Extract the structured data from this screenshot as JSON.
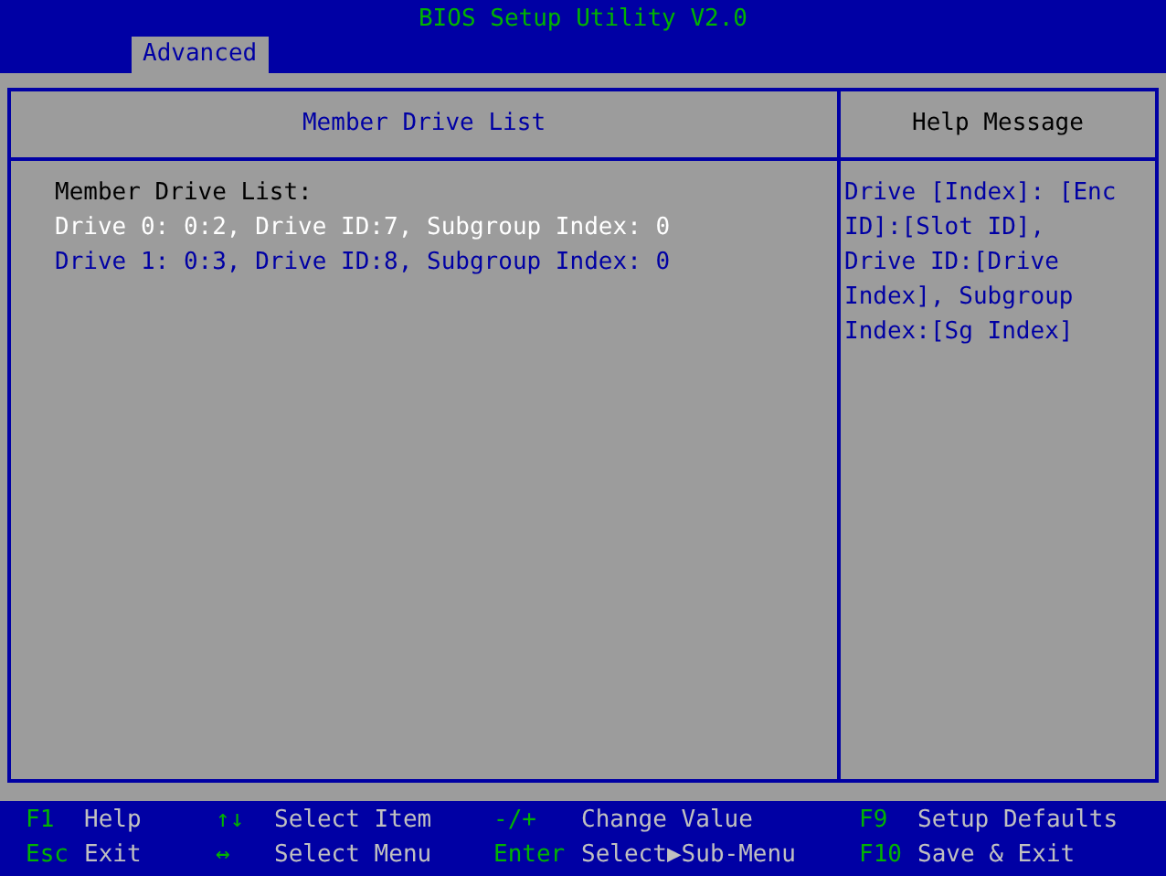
{
  "window": {
    "title": "BIOS Setup Utility V2.0"
  },
  "tabs": [
    {
      "label": "Advanced",
      "selected": true
    }
  ],
  "main_panel": {
    "heading": "Member Drive List",
    "label": "Member Drive List:",
    "items": [
      {
        "text": "Drive 0: 0:2, Drive ID:7, Subgroup Index: 0",
        "selected": true
      },
      {
        "text": "Drive 1: 0:3, Drive ID:8, Subgroup Index: 0",
        "selected": false
      }
    ]
  },
  "help_panel": {
    "heading": "Help Message",
    "lines": [
      "Drive [Index]: [Enc",
      "ID]:[Slot ID],",
      "Drive ID:[Drive",
      "Index], Subgroup",
      "Index:[Sg Index]"
    ]
  },
  "key_legend": [
    [
      {
        "key": "F1",
        "action": "Help"
      },
      {
        "key": "Esc",
        "action": "Exit"
      }
    ],
    [
      {
        "key": "↑↓",
        "action": "Select Item"
      },
      {
        "key": "↔",
        "action": "Select Menu"
      }
    ],
    [
      {
        "key": "-/+",
        "action": "Change Value"
      },
      {
        "key": "Enter",
        "action": "Select▶Sub-Menu"
      }
    ],
    [
      {
        "key": "F9",
        "action": "Setup Defaults"
      },
      {
        "key": "F10",
        "action": "Save & Exit"
      }
    ]
  ]
}
